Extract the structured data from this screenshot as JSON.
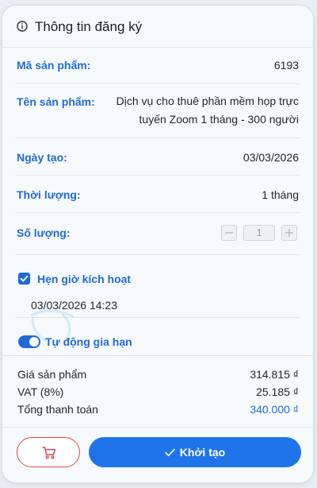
{
  "header": {
    "title": "Thông tin đăng ký",
    "icon": "info-circle-icon"
  },
  "fields": {
    "product_code": {
      "label": "Mã sản phẩm:",
      "value": "6193"
    },
    "product_name": {
      "label": "Tên sản phẩm:",
      "value_line1": "Dịch vụ cho thuê phần mềm họp trực",
      "value_line2": "tuyến Zoom 1 tháng - 300 người"
    },
    "created_date": {
      "label": "Ngày tạo:",
      "value": "03/03/2026"
    },
    "duration": {
      "label": "Thời lượng:",
      "value": "1 tháng"
    },
    "quantity": {
      "label": "Số lượng:",
      "value": "1",
      "decrement": "−",
      "increment": "+"
    }
  },
  "schedule": {
    "label": "Hẹn giờ kích hoạt",
    "checked": true,
    "datetime": "03/03/2026 14:23"
  },
  "auto_renew": {
    "label": "Tự động gia hạn",
    "enabled": true
  },
  "summary": {
    "price_label": "Giá sản phẩm",
    "price_value": "314.815 ₫",
    "vat_label": "VAT (8%)",
    "vat_value": "25.185 ₫",
    "total_label": "Tổng thanh toán",
    "total_value": "340.000 ₫"
  },
  "actions": {
    "cart_icon": "shopping-cart-icon",
    "create_label": "Khởi tạo"
  },
  "colors": {
    "accent": "#1f6ad8",
    "button": "#1f74ea",
    "danger": "#e04848"
  }
}
